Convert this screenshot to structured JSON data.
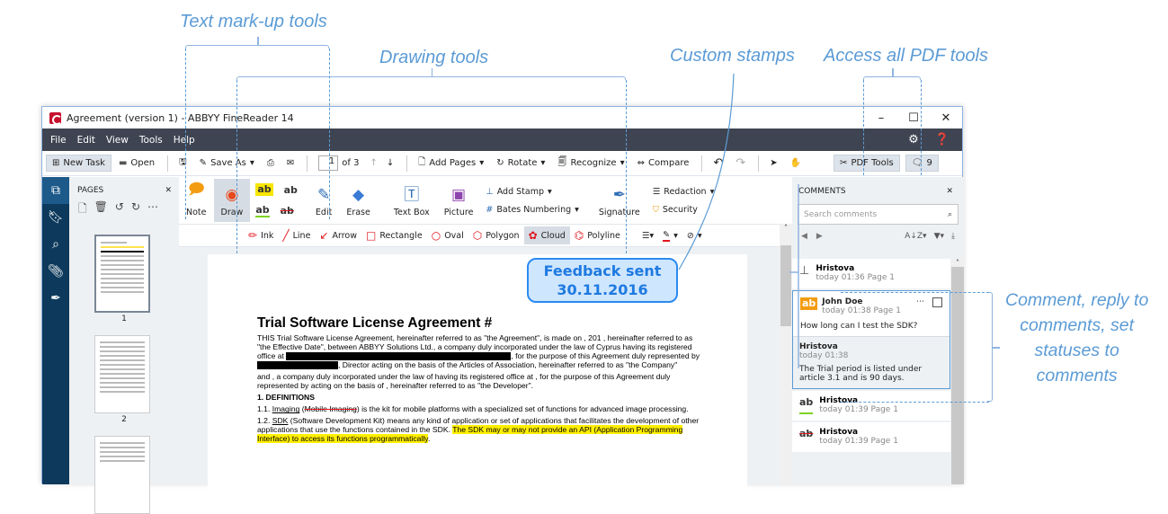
{
  "callouts": {
    "text_markup": "Text mark-up tools",
    "drawing": "Drawing tools",
    "custom_stamps": "Custom stamps",
    "pdf_tools": "Access all PDF tools",
    "comments_line1": "Comment, reply to",
    "comments_line2": "comments, set",
    "comments_line3": "statuses to",
    "comments_line4": "comments"
  },
  "window": {
    "title": "Agreement (version 1) - ABBYY FineReader 14",
    "controls": {
      "minimize": "–",
      "maximize": "☐",
      "close": "✕"
    }
  },
  "menu": [
    "File",
    "Edit",
    "View",
    "Tools",
    "Help"
  ],
  "toolbar": {
    "new_task": "New Task",
    "open": "Open",
    "save_as": "Save As",
    "page_current": "1",
    "page_total": "of 3",
    "add_pages": "Add Pages",
    "rotate": "Rotate",
    "recognize": "Recognize",
    "compare": "Compare",
    "pdf_tools": "PDF Tools",
    "comments_count": "9"
  },
  "pages_panel": {
    "title": "PAGES",
    "pages": [
      "1",
      "2"
    ]
  },
  "ribbon": {
    "note": "Note",
    "draw": "Draw",
    "edit": "Edit",
    "erase": "Erase",
    "text_box": "Text Box",
    "picture": "Picture",
    "add_stamp": "Add Stamp",
    "bates_numbering": "Bates Numbering",
    "signature": "Signature",
    "redaction": "Redaction",
    "security": "Security",
    "markup_glyph": "ab"
  },
  "draw_tools": [
    "Ink",
    "Line",
    "Arrow",
    "Rectangle",
    "Oval",
    "Polygon",
    "Cloud",
    "Polyline"
  ],
  "stamp": {
    "line1": "Feedback sent",
    "line2": "30.11.2016"
  },
  "document": {
    "heading": "Trial Software License Agreement #",
    "p1a": "THIS Trial Software License Agreement, hereinafter referred to as \"the Agreement\", is made on      , 201     , hereinafter referred to as \"the Effective Date\", between ABBYY Solutions Ltd., a company duly incorporated under the law of Cyprus having its registered office at",
    "p1b": ", for the purpose of this Agreement duly represented by",
    "p1c": ", Director acting on the basis of the Articles of Association, hereinafter referred to as \"the Company\"",
    "p2": "and       , a company duly incorporated under the law of          having its registered office at        ,  for  the  purpose  of this Agreement duly represented by                acting on the basis of        , hereinafter referred to as \"the Developer\".",
    "section1": "1.   DEFINITIONS",
    "d11_num": "1.1. ",
    "d11_term": "Imaging",
    "d11_struck": "Mobile Imaging",
    "d11_rest": ") is the kit for mobile platforms with a specialized set of functions for advanced image processing.",
    "d12_num": "1.2. ",
    "d12_term": "SDK",
    "d12_rest": " (Software Development Kit) means any kind of application or set of applications that facilitates the development of other applications that use the functions contained in the SDK. ",
    "d12_hl": "The SDK may or may not provide an API (Application Programming Interface) to access its functions programmatically"
  },
  "comments_panel": {
    "title": "COMMENTS",
    "search_placeholder": "Search comments",
    "items": [
      {
        "author": "Hristova",
        "meta": "today 01:36  Page 1",
        "type": "stamp"
      },
      {
        "author": "John Doe",
        "meta": "today 01:38  Page 1",
        "type": "highlight",
        "text": "How long can I test the SDK?",
        "reply": {
          "author": "Hristova",
          "meta": "today 01:38",
          "text": "The Trial period is listed under article 3.1 and is 90 days."
        }
      },
      {
        "author": "Hristova",
        "meta": "today 01:39  Page 1",
        "type": "underline"
      },
      {
        "author": "Hristova",
        "meta": "today 01:39  Page 1",
        "type": "strikeout"
      }
    ]
  }
}
